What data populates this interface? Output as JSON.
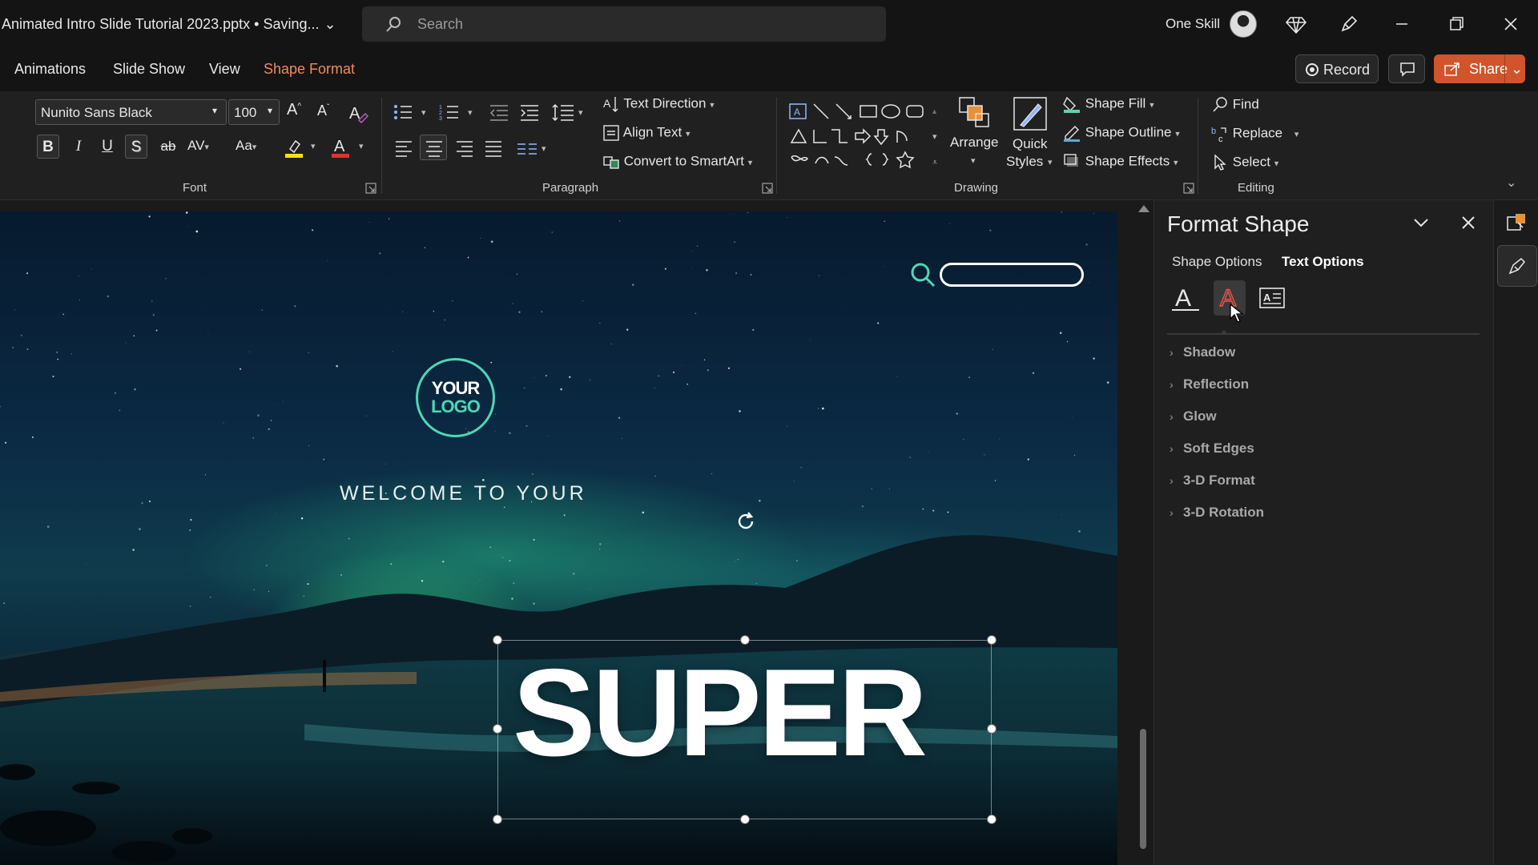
{
  "window": {
    "doc_title": "Animated Intro Slide Tutorial 2023.pptx • Saving...",
    "search_placeholder": "Search",
    "user_name": "One Skill"
  },
  "menu": {
    "tabs": [
      "Animations",
      "Slide Show",
      "View",
      "Shape Format"
    ],
    "record_label": "Record",
    "share_label": "Share"
  },
  "ribbon": {
    "font_name": "Nunito Sans Black",
    "font_size": "100",
    "format_buttons": [
      "B",
      "I",
      "U",
      "S",
      "ab"
    ],
    "font_group_label": "Font",
    "paragraph_group_label": "Paragraph",
    "text_direction_label": "Text Direction",
    "align_text_label": "Align Text",
    "convert_smartart_label": "Convert to SmartArt",
    "drawing_group_label": "Drawing",
    "arrange_label": "Arrange",
    "quick_styles_line1": "Quick",
    "quick_styles_line2": "Styles",
    "shape_fill_label": "Shape Fill",
    "shape_outline_label": "Shape Outline",
    "shape_effects_label": "Shape Effects",
    "find_label": "Find",
    "replace_label": "Replace",
    "select_label": "Select",
    "editing_group_label": "Editing"
  },
  "slide": {
    "logo_line1": "YOUR",
    "logo_line2": "LOGO",
    "welcome_text": "WELCOME TO YOUR",
    "headline": "SUPER",
    "accent_color": "#4fd6b4"
  },
  "pane": {
    "title": "Format Shape",
    "tab_shape_options": "Shape Options",
    "tab_text_options": "Text Options",
    "sections": [
      "Shadow",
      "Reflection",
      "Glow",
      "Soft Edges",
      "3-D Format",
      "3-D Rotation"
    ]
  },
  "colors": {
    "brand_orange": "#d1542a",
    "shape_format_tab": "#f08a5d"
  }
}
